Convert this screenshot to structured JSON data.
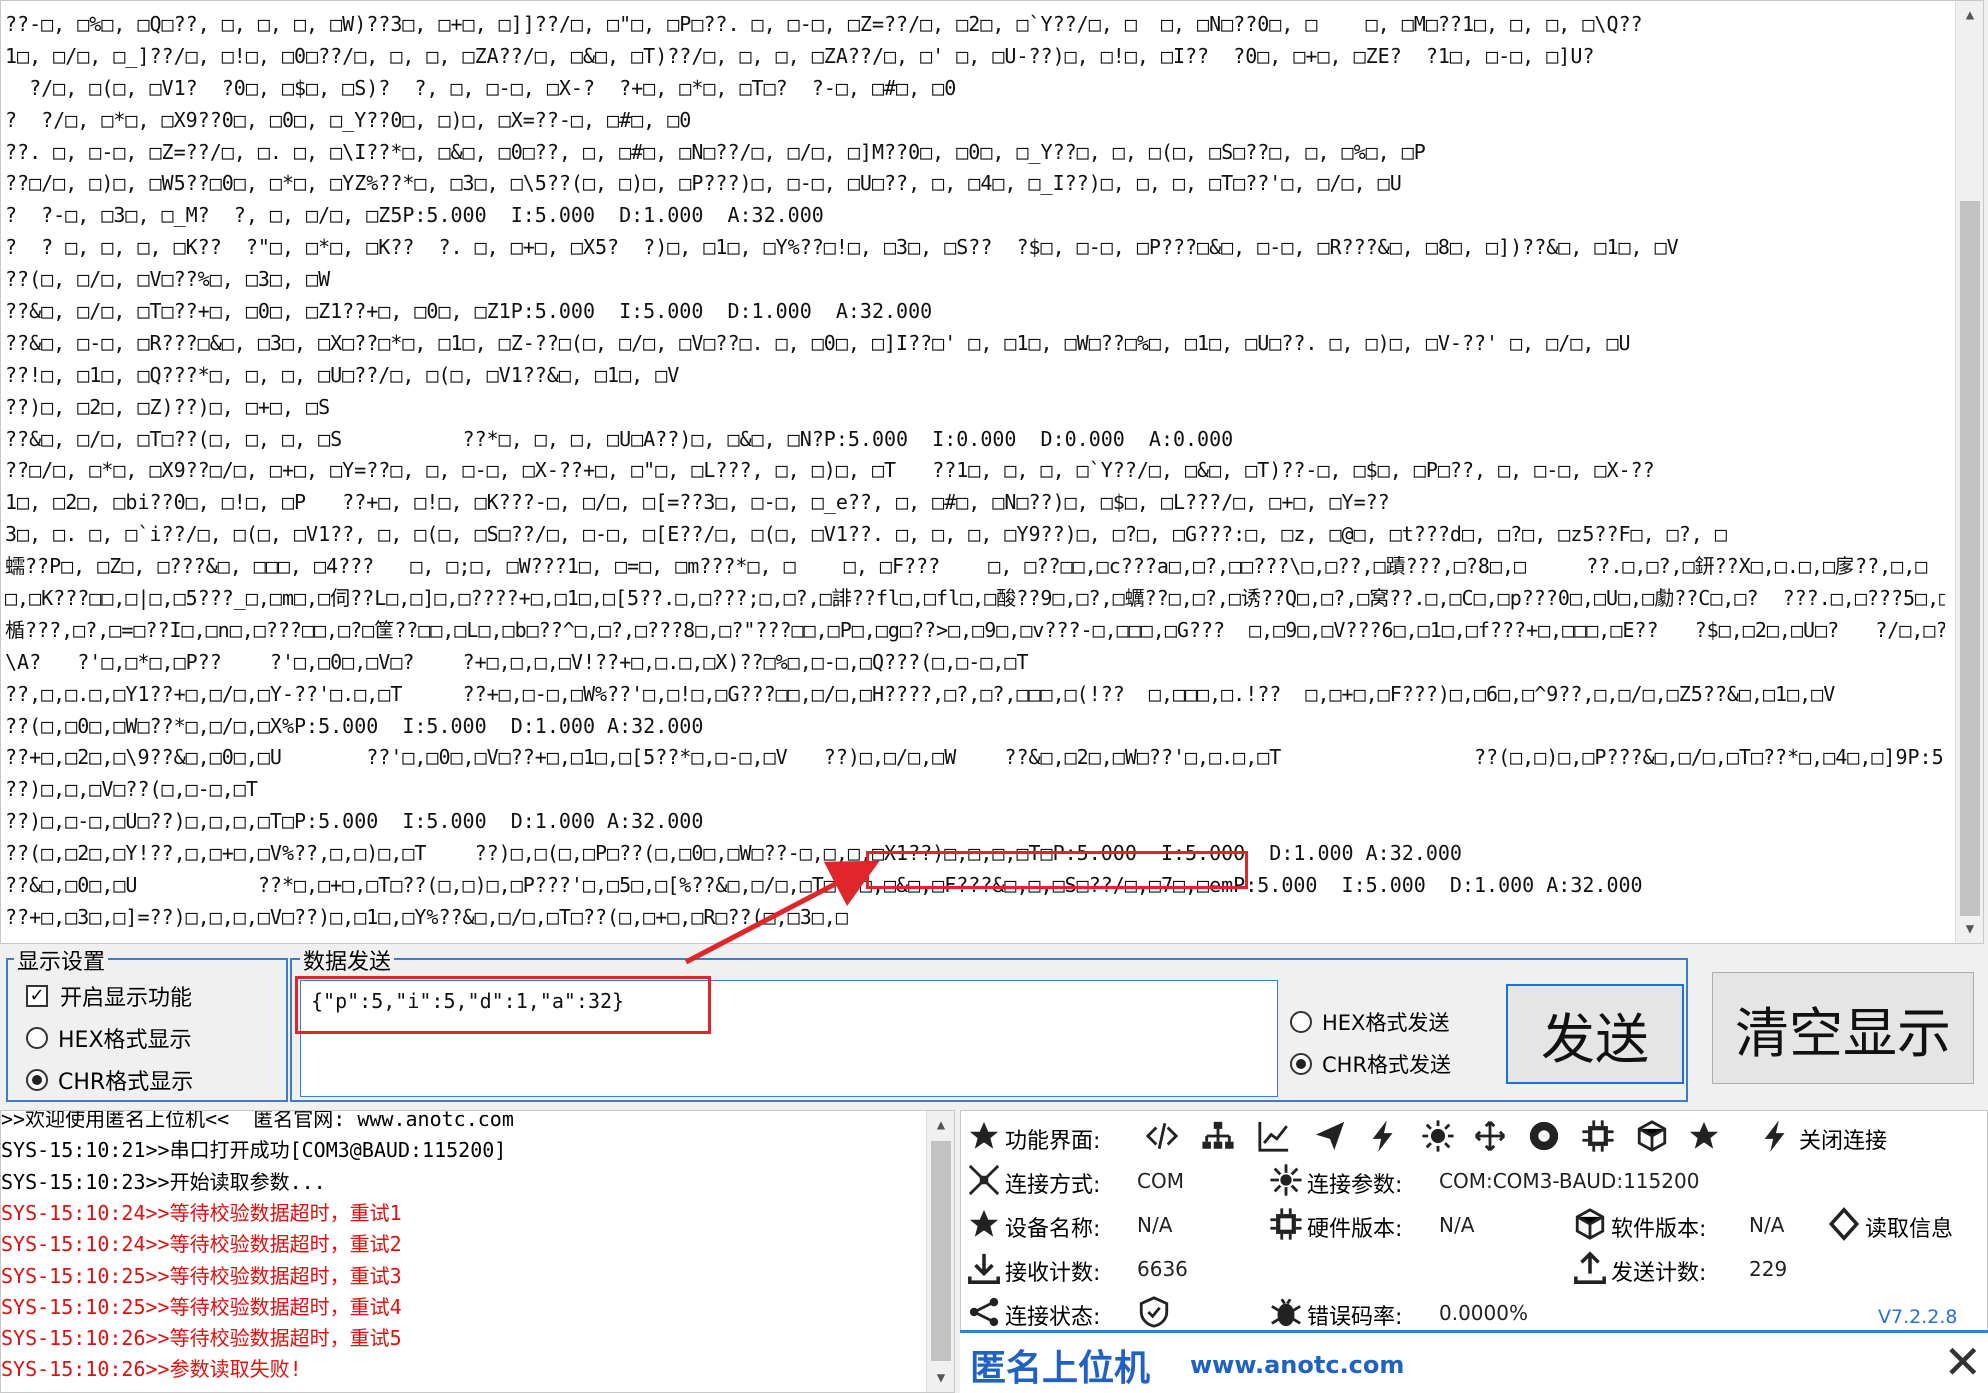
{
  "receive": {
    "lines": [
      "??-□, □%□, □Q□??, □, □, □, □W)??3□, □+□, □]]??/□, □\"□, □P□??. □, □-□, □Z=??/□, □2□, □`Y??/□, □  □, □N□??0□, □    □, □M□??1□, □, □, □\\Q??",
      "1□, □/□, □_]??/□, □!□, □0□??/□, □, □, □ZA??/□, □&□, □T)??/□, □, □, □ZA??/□, □' □, □U-??)□, □!□, □I??  ?0□, □+□, □ZE?  ?1□, □-□, □]U?",
      "  ?/□, □(□, □V1?  ?0□, □$□, □S)?  ?, □, □-□, □X-?  ?+□, □*□, □T□?  ?-□, □#□, □0",
      "?  ?/□, □*□, □X9??0□, □0□, □_Y??0□, □)□, □X=??-□, □#□, □0",
      "??. □, □-□, □Z=??/□, □. □, □\\I??*□, □&□, □0□??, □, □#□, □N□??/□, □/□, □]M??0□, □0□, □_Y??□, □, □(□, □S□??□, □, □%□, □P",
      "??□/□, □)□, □W5??□0□, □*□, □YZ%??*□, □3□, □\\5??(□, □)□, □P???)□, □-□, □U□??, □, □4□, □_I??)□, □, □, □T□??'□, □/□, □U",
      "?  ?-□, □3□, □_M?  ?, □, □/□, □Z5P:5.000  I:5.000  D:1.000  A:32.000",
      "?  ? □, □, □, □K??  ?\"□, □*□, □K??  ?. □, □+□, □X5?  ?)□, □1□, □Y%??□!□, □3□, □S??  ?$□, □-□, □P???□&□, □-□, □R???&□, □8□, □])??&□, □1□, □V",
      "??(□, □/□, □V□??%□, □3□, □W",
      "??&□, □/□, □T□??+□, □0□, □Z1??+□, □0□, □Z1P:5.000  I:5.000  D:1.000  A:32.000",
      "??&□, □-□, □R???□&□, □3□, □X□??□*□, □1□, □Z-??□(□, □/□, □V□??□. □, □0□, □]I??□' □, □1□, □W□??□%□, □1□, □U□??. □, □)□, □V-??' □, □/□, □U",
      "??!□, □1□, □Q???*□, □, □, □U□??/□, □(□, □V1??&□, □1□, □V",
      "??)□, □2□, □Z)??)□, □+□, □S",
      "??&□, □/□, □T□??(□, □, □, □S          ??*□, □, □, □U□A??)□, □&□, □N?P:5.000  I:0.000  D:0.000  A:0.000",
      "??□/□, □*□, □X9??□/□, □+□, □Y=??□, □, □-□, □X-??+□, □\"□, □L???, □, □)□, □T   ??1□, □, □, □`Y??/□, □&□, □T)??-□, □$□, □P□??, □, □-□, □X-??",
      "1□, □2□, □bi??0□, □!□, □P   ??+□, □!□, □K???-□, □/□, □[=??3□, □-□, □_e??, □, □#□, □N□??)□, □$□, □L???/□, □+□, □Y=??",
      "3□, □. □, □`i??/□, □(□, □V1??, □, □(□, □S□??/□, □-□, □[E??/□, □(□, □V1??. □, □, □, □Y9??)□, □?□, □G???:□, □z, □@□, □t???d□, □?□, □z5??F□, □?, □",
      "蠕??P□, □Z□, □???&□, □□□, □4???   □, □;□, □W???1□, □=□, □m???*□, □    □, □F???    □, □??□□,□c???a□,□?,□□???\\□,□??,□蹟???,□?8□,□     ??.□,□?,□鈃??X□,□.□,□扅??,□,□",
      "□,□K???□□,□|□,□5???_□,□m□,□伺??L□,□]□,□????+□,□1□,□[5??.□,□???;□,□?,□誹??fl□,□fl□,□酸??9□,□?,□蠣??□,□?,□诱??Q□,□?,□窝??.□,□C□,□p???0□,□U□,□勮??C□,□?  ???.□,□???5□,□□□□□??G□,□Q□,□",
      "楯???,□?,□=□??I□,□n□,□???□□,□?□筐??□□,□L□,□b□??^□,□?,□???8□,□?\"???□□,□P□,□g□??>□,□9□,□v???-□,□□□,□G???  □,□9□,□V???6□,□1□,□f???+□,□□□,□E??   ?$□,□2□,□U□?   ?/□,□?□,□m??   ?-□,□0□,□",
      "\\A?   ?'□,□*□,□P??    ?'□,□0□,□V□?    ?+□,□,□,□V!??+□,□.□,□X)??□%□,□-□,□Q???(□,□-□,□T",
      "??,□,□.□,□Y1??+□,□/□,□Y-??'□.□,□T     ??+□,□-□,□W%??'□,□!□,□G???□□,□/□,□H????,□?,□?,□□□,□(!??  □,□□□,□.!??  □,□+□,□F???)□,□6□,□^9??,□,□/□,□Z5??&□,□1□,□V",
      "??(□,□0□,□W□??*□,□/□,□X%P:5.000  I:5.000  D:1.000 A:32.000",
      "??+□,□2□,□\\9??&□,□0□,□U       ??'□,□0□,□V□??+□,□1□,□[5??*□,□-□,□V   ??)□,□/□,□W    ??&□,□2□,□W□??'□,□.□,□T                ??(□,□)□,□P???&□,□/□,□T□??*□,□4□,□]9P:5.000  I:5.000  D:1.000 A:32.000",
      "??)□,□,□V□??(□,□-□,□T",
      "??)□,□-□,□U□??)□,□,□,□T□P:5.000  I:5.000  D:1.000 A:32.000",
      "??(□,□2□,□Y!??,□,□+□,□V%??,□,□)□,□T    ??)□,□(□,□P□??(□,□0□,□W□??-□,□,□,□X1??)□,□,□,□T□P:5.000  I:5.000  D:1.000 A:32.000",
      "??&□,□0□,□U          ??*□,□+□,□T□??(□,□)□,□P???'□,□5□,□[%??&□,□/□,□T□??□,□&□,□F???&□,□,□S□??/□,□7□,□emP:5.000  I:5.000  D:1.000 A:32.000",
      "??+□,□3□,□]=??)□,□,□,□V□??)□,□1□,□Y%??&□,□/□,□T□??(□,□+□,□R□??(□,□3□,□"
    ]
  },
  "display_settings": {
    "title": "显示设置",
    "enable_label": "开启显示功能",
    "hex_label": "HEX格式显示",
    "chr_label": "CHR格式显示",
    "enable_checked": true,
    "selected": "CHR"
  },
  "send": {
    "title": "数据发送",
    "input_value": "{\"p\":5,\"i\":5,\"d\":1,\"a\":32}",
    "hex_label": "HEX格式发送",
    "chr_label": "CHR格式发送",
    "selected": "CHR",
    "send_button": "发送",
    "clear_button": "清空显示"
  },
  "log": {
    "lines": [
      {
        "text": ">>欢迎使用匿名上位机<<  匿名官网: www.anotc.com",
        "color": "#000000"
      },
      {
        "text": "SYS-15:10:21>>串口打开成功[COM3@BAUD:115200]",
        "color": "#000000"
      },
      {
        "text": "SYS-15:10:23>>开始读取参数...",
        "color": "#000000"
      },
      {
        "text": "SYS-15:10:24>>等待校验数据超时，重试1",
        "color": "#e01010"
      },
      {
        "text": "SYS-15:10:24>>等待校验数据超时，重试2",
        "color": "#e01010"
      },
      {
        "text": "SYS-15:10:25>>等待校验数据超时，重试3",
        "color": "#e01010"
      },
      {
        "text": "SYS-15:10:25>>等待校验数据超时，重试4",
        "color": "#e01010"
      },
      {
        "text": "SYS-15:10:26>>等待校验数据超时，重试5",
        "color": "#e01010"
      },
      {
        "text": "SYS-15:10:26>>参数读取失败!",
        "color": "#e01010"
      }
    ]
  },
  "info": {
    "func_label": "功能界面:",
    "close_conn": "关闭连接",
    "conn_mode_label": "连接方式:",
    "conn_mode_value": "COM",
    "conn_param_label": "连接参数:",
    "conn_param_value": "COM:COM3-BAUD:115200",
    "device_name_label": "设备名称:",
    "device_name_value": "N/A",
    "hw_ver_label": "硬件版本:",
    "hw_ver_value": "N/A",
    "sw_ver_label": "软件版本:",
    "sw_ver_value": "N/A",
    "read_info": "读取信息",
    "recv_count_label": "接收计数:",
    "recv_count_value": "6636",
    "send_count_label": "发送计数:",
    "send_count_value": "229",
    "conn_state_label": "连接状态:",
    "error_rate_label": "错误码率:",
    "error_rate_value": "0.0000%",
    "version": "V7.2.2.8",
    "brand_name": "匿名上位机",
    "brand_url": "www.anotc.com"
  },
  "colors": {
    "accent": "#3d7ccb",
    "highlight": "#e0252b",
    "brand": "#1f62c4",
    "error": "#e01010"
  }
}
